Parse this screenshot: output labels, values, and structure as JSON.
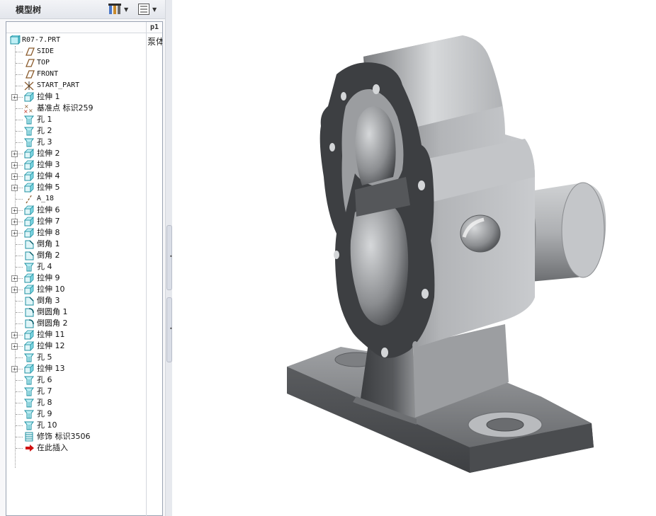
{
  "panel": {
    "title": "模型树",
    "settings_icon": "tree-settings-icon",
    "show_icon": "tree-columns-icon",
    "column_header": "p1",
    "column_value": "泵体"
  },
  "tree": {
    "root": {
      "label": "R07-7.PRT",
      "icon": "part-icon"
    },
    "items": [
      {
        "label": "SIDE",
        "icon": "datum-plane-icon",
        "expandable": false,
        "mono": true
      },
      {
        "label": "TOP",
        "icon": "datum-plane-icon",
        "expandable": false,
        "mono": true
      },
      {
        "label": "FRONT",
        "icon": "datum-plane-icon",
        "expandable": false,
        "mono": true
      },
      {
        "label": "START_PART",
        "icon": "csys-icon",
        "expandable": false,
        "mono": true
      },
      {
        "label": "拉伸 1",
        "icon": "extrude-icon",
        "expandable": true
      },
      {
        "label": "基准点 标识259",
        "icon": "datum-point-icon",
        "expandable": false
      },
      {
        "label": "孔 1",
        "icon": "hole-icon",
        "expandable": false
      },
      {
        "label": "孔 2",
        "icon": "hole-icon",
        "expandable": false
      },
      {
        "label": "孔 3",
        "icon": "hole-icon",
        "expandable": false
      },
      {
        "label": "拉伸 2",
        "icon": "extrude-icon",
        "expandable": true
      },
      {
        "label": "拉伸 3",
        "icon": "extrude-icon",
        "expandable": true
      },
      {
        "label": "拉伸 4",
        "icon": "extrude-icon",
        "expandable": true
      },
      {
        "label": "拉伸 5",
        "icon": "extrude-icon",
        "expandable": true
      },
      {
        "label": "A_18",
        "icon": "datum-axis-icon",
        "expandable": false,
        "mono": true
      },
      {
        "label": "拉伸 6",
        "icon": "extrude-icon",
        "expandable": true
      },
      {
        "label": "拉伸 7",
        "icon": "extrude-icon",
        "expandable": true
      },
      {
        "label": "拉伸 8",
        "icon": "extrude-icon",
        "expandable": true
      },
      {
        "label": "倒角 1",
        "icon": "chamfer-icon",
        "expandable": false
      },
      {
        "label": "倒角 2",
        "icon": "chamfer-icon",
        "expandable": false
      },
      {
        "label": "孔 4",
        "icon": "hole-icon",
        "expandable": false
      },
      {
        "label": "拉伸 9",
        "icon": "extrude-icon",
        "expandable": true
      },
      {
        "label": "拉伸 10",
        "icon": "extrude-icon",
        "expandable": true
      },
      {
        "label": "倒角 3",
        "icon": "chamfer-icon",
        "expandable": false
      },
      {
        "label": "倒圆角 1",
        "icon": "round-icon",
        "expandable": false
      },
      {
        "label": "倒圆角 2",
        "icon": "round-icon",
        "expandable": false
      },
      {
        "label": "拉伸 11",
        "icon": "extrude-icon",
        "expandable": true
      },
      {
        "label": "拉伸 12",
        "icon": "extrude-icon",
        "expandable": true
      },
      {
        "label": "孔 5",
        "icon": "hole-icon",
        "expandable": false
      },
      {
        "label": "拉伸 13",
        "icon": "extrude-icon",
        "expandable": true
      },
      {
        "label": "孔 6",
        "icon": "hole-icon",
        "expandable": false
      },
      {
        "label": "孔 7",
        "icon": "hole-icon",
        "expandable": false
      },
      {
        "label": "孔 8",
        "icon": "hole-icon",
        "expandable": false
      },
      {
        "label": "孔 9",
        "icon": "hole-icon",
        "expandable": false
      },
      {
        "label": "孔 10",
        "icon": "hole-icon",
        "expandable": false
      },
      {
        "label": "修饰 标识3506",
        "icon": "cosmetic-thread-icon",
        "expandable": false
      },
      {
        "label": "在此插入",
        "icon": "insert-here-icon",
        "expandable": false
      }
    ]
  },
  "viewport": {
    "model": "pump-body-3d-model"
  },
  "colors": {
    "accent_cyan": "#1fb6c9",
    "datum_brown": "#8a5a2b",
    "insert_red": "#d01010",
    "model_dark": "#3d3f42",
    "model_light": "#c9cbce"
  }
}
